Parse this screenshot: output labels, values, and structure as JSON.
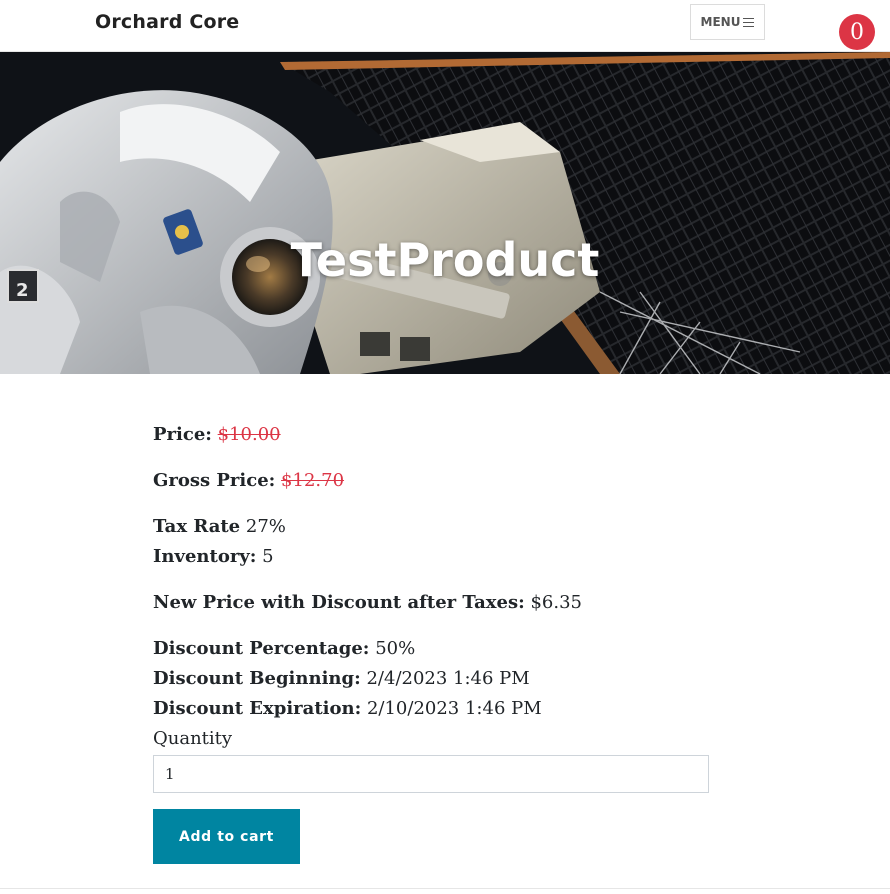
{
  "navbar": {
    "brand": "Orchard Core",
    "menu_label": "MENU",
    "menu_icon": "hamburger-icon",
    "cart_count": "0",
    "cart_color": "#dc3545"
  },
  "hero": {
    "title": "TestProduct",
    "image": "astronaut-spacewalk-image"
  },
  "product": {
    "price_label": "Price:",
    "price_value": "$10.00",
    "gross_label": "Gross Price:",
    "gross_value": "$12.70",
    "tax_label": "Tax Rate",
    "tax_value": "27%",
    "inventory_label": "Inventory:",
    "inventory_value": "5",
    "new_price_label": "New Price with Discount after Taxes:",
    "new_price_value": "$6.35",
    "discount_pct_label": "Discount Percentage:",
    "discount_pct_value": "50%",
    "discount_begin_label": "Discount Beginning:",
    "discount_begin_value": "2/4/2023 1:46 PM",
    "discount_exp_label": "Discount Expiration:",
    "discount_exp_value": "2/10/2023 1:46 PM",
    "quantity_label": "Quantity",
    "quantity_value": "1",
    "add_to_cart_label": "Add to cart",
    "accent_color": "#0085a1",
    "strike_color": "#dc3545"
  }
}
